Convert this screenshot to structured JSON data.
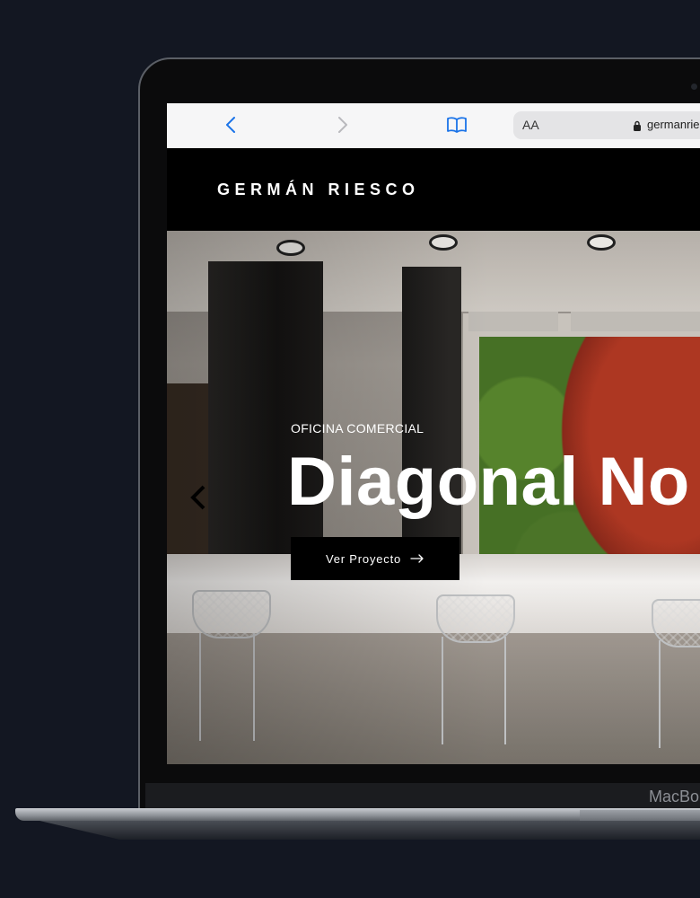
{
  "device": {
    "label": "MacBo"
  },
  "browser": {
    "address_bar": {
      "reader_label": "AA",
      "url": "germanrie"
    },
    "icons": [
      "chevron-left-icon",
      "chevron-right-icon",
      "bookmarks-book-icon",
      "lock-icon"
    ]
  },
  "site": {
    "brand": "GERMÁN RIESCO"
  },
  "hero": {
    "eyebrow": "OFICINA COMERCIAL",
    "title": "Diagonal No",
    "cta_label": "Ver Proyecto",
    "cta_icon": "arrow-right-icon",
    "prev_icon": "chevron-left-icon"
  },
  "colors": {
    "page_background": "#131722",
    "browser_accent": "#1a73e8",
    "header_background": "#000000",
    "cta_background": "#000000"
  }
}
